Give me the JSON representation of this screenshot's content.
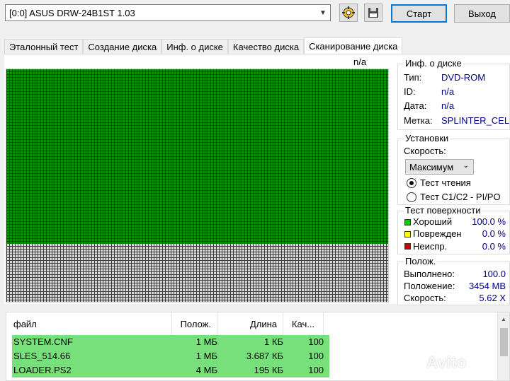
{
  "toolbar": {
    "drive_selected": "[0:0]  ASUS DRW-24B1ST 1.03",
    "start_label": "Старт",
    "exit_label": "Выход",
    "icons": [
      "settings-icon",
      "save-icon"
    ]
  },
  "tabs": [
    {
      "label": "Эталонный тест",
      "active": false
    },
    {
      "label": "Создание диска",
      "active": false
    },
    {
      "label": "Инф. о диске",
      "active": false
    },
    {
      "label": "Качество диска",
      "active": false
    },
    {
      "label": "Сканирование диска",
      "active": true
    }
  ],
  "scan": {
    "label": "n/a",
    "good_fraction": 0.75,
    "colors": {
      "good": "#0c8f0c",
      "unscanned": "#d8d8d8"
    }
  },
  "disc_info": {
    "title": "Инф. о диске",
    "type_label": "Тип:",
    "type_value": "DVD-ROM",
    "id_label": "ID:",
    "id_value": "n/a",
    "date_label": "Дата:",
    "date_value": "n/a",
    "volume_label": "Метка:",
    "volume_value": "SPLINTER_CELL"
  },
  "settings": {
    "title": "Установки",
    "speed_label": "Скорость:",
    "speed_value": "Максимум",
    "read_test_label": "Тест чтения",
    "c1c2_test_label": "Тест C1/C2 - PI/PO",
    "read_test_selected": true
  },
  "surface": {
    "title": "Тест поверхности",
    "good_label": "Хороший",
    "good_value": "100.0 %",
    "good_color": "#00cc00",
    "damaged_label": "Поврежден",
    "damaged_value": "0.0 %",
    "damaged_color": "#ffff00",
    "unreadable_label": "Неиспр.",
    "unreadable_value": "0.0 %",
    "unreadable_color": "#cc0000"
  },
  "position": {
    "title": "Полож.",
    "done_label": "Выполнено:",
    "done_value": "100.0",
    "position_label": "Положение:",
    "position_value": "3454 MB",
    "speed_label": "Скорость:",
    "speed_value": "5.62 X"
  },
  "file_list": {
    "columns": [
      "файл",
      "Полож.",
      "Длина",
      "Кач..."
    ],
    "rows": [
      {
        "file": "SYSTEM.CNF",
        "pos": "1 МБ",
        "len": "1 КБ",
        "quality": "100"
      },
      {
        "file": "SLES_514.66",
        "pos": "1 МБ",
        "len": "3.687 КБ",
        "quality": "100"
      },
      {
        "file": "LOADER.PS2",
        "pos": "4 МБ",
        "len": "195 КБ",
        "quality": "100"
      }
    ]
  },
  "watermark": "Avito"
}
